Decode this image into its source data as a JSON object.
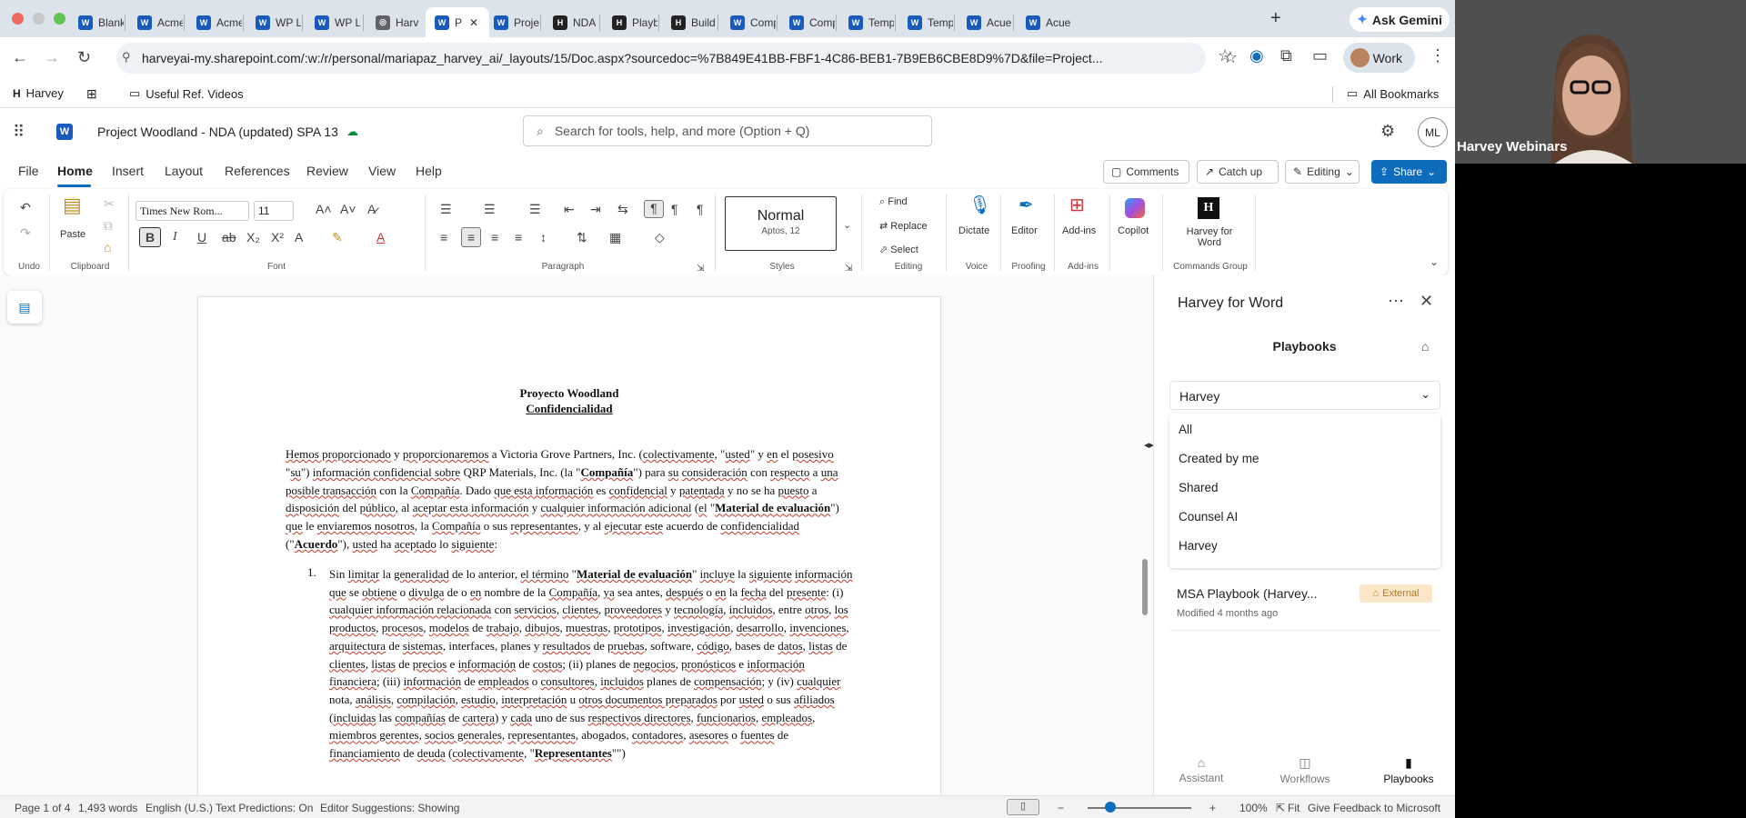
{
  "browser": {
    "tabs": [
      {
        "label": "Blank",
        "icon": "word-icon",
        "color": "#185abd"
      },
      {
        "label": "Acme",
        "icon": "word-icon",
        "color": "#185abd"
      },
      {
        "label": "Acme",
        "icon": "word-icon",
        "color": "#185abd"
      },
      {
        "label": "WP L",
        "icon": "word-icon",
        "color": "#185abd"
      },
      {
        "label": "WP L",
        "icon": "word-icon",
        "color": "#185abd"
      },
      {
        "label": "Harv",
        "icon": "globe-icon",
        "color": "#5f6368"
      },
      {
        "label": "P",
        "icon": "word-icon",
        "color": "#185abd"
      },
      {
        "label": "Proje",
        "icon": "word-icon",
        "color": "#185abd"
      },
      {
        "label": "NDA",
        "icon": "harvey-icon",
        "color": "#222222"
      },
      {
        "label": "Playb",
        "icon": "harvey-icon",
        "color": "#222222"
      },
      {
        "label": "Build",
        "icon": "harvey-icon",
        "color": "#222222"
      },
      {
        "label": "Comp",
        "icon": "word-icon",
        "color": "#185abd"
      },
      {
        "label": "Comp",
        "icon": "word-icon",
        "color": "#185abd"
      },
      {
        "label": "Temp",
        "icon": "word-icon",
        "color": "#185abd"
      },
      {
        "label": "Temp",
        "icon": "word-icon",
        "color": "#185abd"
      },
      {
        "label": "Acue",
        "icon": "word-icon",
        "color": "#185abd"
      },
      {
        "label": "Acue",
        "icon": "word-icon",
        "color": "#185abd"
      }
    ],
    "gemini_label": "Ask Gemini",
    "url": "harveyai-my.sharepoint.com/:w:/r/personal/mariapaz_harvey_ai/_layouts/15/Doc.aspx?sourcedoc=%7B849E41BB-FBF1-4C86-BEB1-7B9EB6CBE8D9%7D&file=Project...",
    "profile_label": "Work",
    "bookmarks": {
      "harvey": "Harvey",
      "videos": "Useful Ref. Videos",
      "all": "All Bookmarks"
    }
  },
  "word": {
    "doc_title": "Project Woodland - NDA (updated) SPA 13",
    "search_placeholder": "Search for tools, help, and more (Option + Q)",
    "avatar_initials": "ML",
    "menu": [
      "File",
      "Home",
      "Insert",
      "Layout",
      "References",
      "Review",
      "View",
      "Help"
    ],
    "comments_label": "Comments",
    "catchup_label": "Catch up",
    "editing_label": "Editing",
    "share_label": "Share",
    "ribbon": {
      "undo_group": "Undo",
      "paste_label": "Paste",
      "clipboard_group": "Clipboard",
      "font_name": "Times New Rom...",
      "font_size": "11",
      "font_group": "Font",
      "paragraph_group": "Paragraph",
      "style_name": "Normal",
      "style_font": "Aptos, 12",
      "styles_group": "Styles",
      "find_label": "Find",
      "replace_label": "Replace",
      "select_label": "Select",
      "editing_group": "Editing",
      "dictate_label": "Dictate",
      "voice_group": "Voice",
      "editor_label": "Editor",
      "proofing_group": "Proofing",
      "addins_label": "Add-ins",
      "addins_group": "Add-ins",
      "copilot_label": "Copilot",
      "harvey_label_1": "Harvey for",
      "harvey_label_2": "Word",
      "commands_group": "Commands Group"
    }
  },
  "document": {
    "heading": "Proyecto Woodland",
    "subheading": "Confidencialidad",
    "para1_html": "<span class='sq'>Hemos proporcionado</span> y <span class='sq'>proporcionaremos</span> a Victoria Grove Partners, Inc. (<span class='sq'>colectivamente</span>, \"<span class='sq'>usted</span>\" y <span class='sq'>en</span> el <span class='sq'>posesivo</span> \"<span class='sq'>su</span>\") <span class='sq'>información confidencial sobre</span> QRP Materials, Inc. (la \"<b class='sq'>Compañía</b>\") para <span class='sq'>su</span> <span class='sq'>consideración</span> con <span class='sq'>respecto</span> a <span class='sq'>una posible transacción</span> con la <span class='sq'>Compañía</span>. Dado <span class='sq'>que esta información</span> es <span class='sq'>confidencial</span> y <span class='sq'>patentada</span> y no se ha <span class='sq'>puesto</span> a <span class='sq'>disposición</span> del <span class='sq'>público</span>, al <span class='sq'>aceptar esta información</span> y <span class='sq'>cualquier información adicional</span> (<span class='sq'>el</span> \"<b class='sq'>Material de evaluación</b>\") <span class='sq'>que</span> le <span class='sq'>enviaremos nosotros</span>, la <span class='sq'>Compañía</span> o sus <span class='sq'>representantes</span>, y al <span class='sq'>ejecutar este</span> acuerdo de <span class='sq'>confidencialidad</span> (\"<b class='sq'>Acuerdo</b>\"), <span class='sq'>usted</span> ha <span class='sq'>aceptado</span> lo <span class='sq'>siguiente</span>:",
    "item_number": "1.",
    "para2_html": "Sin <span class='sq'>limitar</span> la <span class='sq'>generalidad</span> de lo anterior, <span class='sq'>el término</span> \"<b class='sq'>Material de evaluación</b>\" <span class='sq'>incluye</span> la <span class='sq'>siguiente</span> <span class='sq'>información</span> <span class='sq'>que</span> se <span class='sq'>obtiene</span> o <span class='sq'>divulga</span> de o <span class='sq'>en</span> nombre de la <span class='sq'>Compañía</span>, <span class='sq'>ya</span> sea antes, <span class='sq'>después</span> o <span class='sq'>en</span> la <span class='sq'>fecha</span> del <span class='sq'>presente</span>: (i) <span class='sq'>cualquier información relacionada</span> con <span class='sq'>servicios</span>, <span class='sq'>clientes</span>, <span class='sq'>proveedores</span> y <span class='sq'>tecnología</span>, <span class='sq'>incluidos</span>, entre <span class='sq'>otros</span>, <span class='sq'>los productos</span>, <span class='sq'>procesos</span>, <span class='sq'>modelos</span> de <span class='sq'>trabajo</span>, <span class='sq'>dibujos</span>, <span class='sq'>muestras</span>, <span class='sq'>prototipos</span>, <span class='sq'>investigación</span>, <span class='sq'>desarrollo</span>, <span class='sq'>invenciones</span>, <span class='sq'>arquitectura</span> de <span class='sq'>sistemas</span>, interfaces, planes y <span class='sq'>resultados</span> de <span class='sq'>pruebas</span>, software, <span class='sq'>código</span>, bases de <span class='sq'>datos</span>, <span class='sq'>listas</span> de <span class='sq'>clientes</span>, <span class='sq'>listas</span> de <span class='sq'>precios</span> e <span class='sq'>información</span> de <span class='sq'>costos</span>; (ii) planes de <span class='sq'>negocios</span>, <span class='sq'>pronósticos</span> e <span class='sq'>información financiera</span>; (iii) <span class='sq'>información</span> de <span class='sq'>empleados</span> o <span class='sq'>consultores</span>, <span class='sq'>incluidos</span> planes de <span class='sq'>compensación</span>; y (iv) <span class='sq'>cualquier</span> nota, <span class='sq'>análisis</span>, <span class='sq'>compilación</span>, <span class='sq'>estudio</span>, <span class='sq'>interpretación</span> u <span class='sq'>otros documentos preparados</span> por <span class='sq'>usted</span> o sus <span class='sq'>afiliados</span> (<span class='sq'>incluidas</span> las <span class='sq'>compañías</span> de <span class='sq'>cartera</span>) y <span class='sq'>cada</span> uno de sus <span class='sq'>respectivos directores</span>, <span class='sq'>funcionarios</span>, <span class='sq'>empleados</span>, <span class='sq'>miembros gerentes</span>, <span class='sq'>socios generales</span>, <span class='sq'>representantes</span>, abogados, <span class='sq'>contadores</span>, <span class='sq'>asesores</span> o <span class='sq'>fuentes</span> de <span class='sq'>financiamiento</span> de <span class='sq'>deuda</span> (<span class='sq'>colectivamente</span>, \"<b class='sq'>Representantes</b>\"\")"
  },
  "harvey_panel": {
    "title": "Harvey for Word",
    "section_title": "Playbooks",
    "selected_filter": "Harvey",
    "dropdown_options": [
      "All",
      "Created by me",
      "Shared",
      "Counsel AI",
      "Harvey"
    ],
    "playbook_name": "MSA Playbook (Harvey...",
    "playbook_modified": "Modified 4 months ago",
    "external_badge": "External",
    "bottom_tabs": [
      "Assistant",
      "Workflows",
      "Playbooks"
    ]
  },
  "status_bar": {
    "page": "Page 1 of 4",
    "words": "1,493 words",
    "language": "English (U.S.)",
    "text_predictions": "Text Predictions: On",
    "editor_suggestions": "Editor Suggestions: Showing",
    "zoom": "100%",
    "fit": "Fit",
    "feedback": "Give Feedback to Microsoft"
  },
  "video": {
    "label": "Harvey Webinars"
  }
}
